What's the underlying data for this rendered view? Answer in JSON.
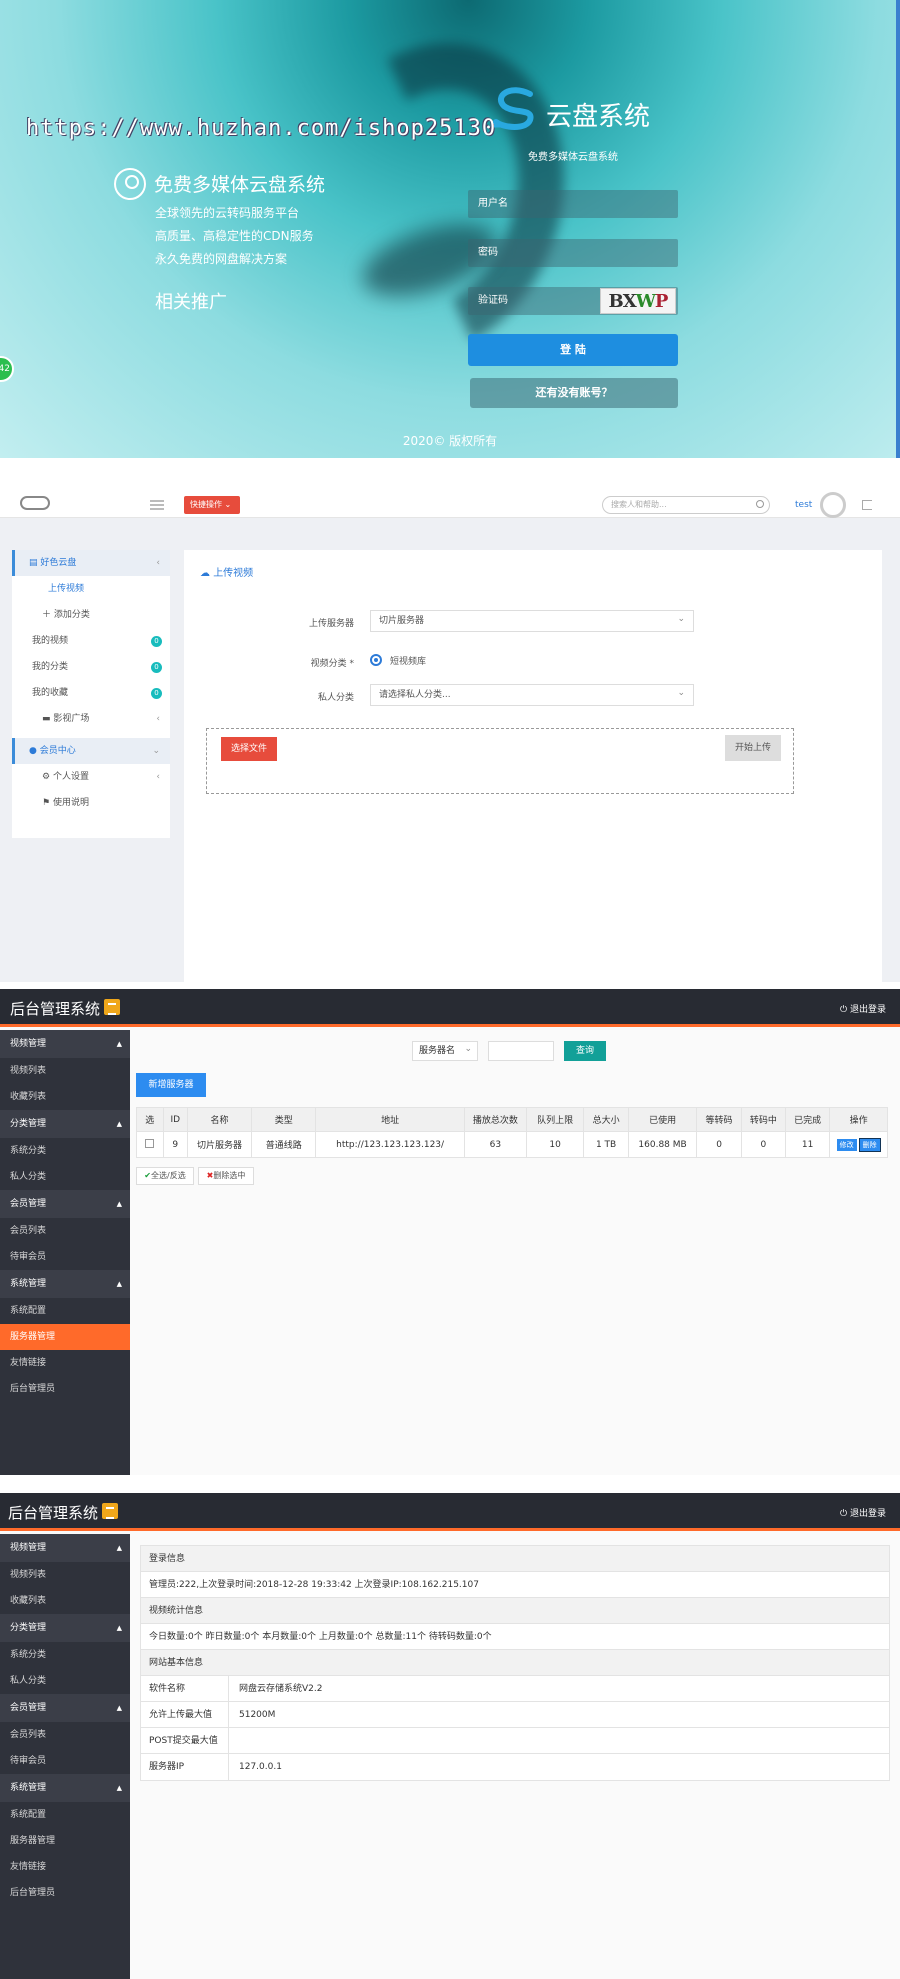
{
  "login": {
    "watermark": "https://www.huzhan.com/ishop25130",
    "logo_text": "云盘系统",
    "logo_sub": "免费多媒体云盘系统",
    "promo_title": "免费多媒体云盘系统",
    "promo_lines": [
      "全球领先的云转码服务平台",
      "高质量、高稳定性的CDN服务",
      "永久免费的网盘解决方案"
    ],
    "promo_more": "相关推广",
    "username_placeholder": "用户名",
    "password_placeholder": "密码",
    "captcha_placeholder": "验证码",
    "captcha_text": [
      "B",
      "X",
      "W",
      "P"
    ],
    "login_button": "登 陆",
    "register_button": "还有没有账号？",
    "copyright": "2020© 版权所有",
    "side_badge": "42"
  },
  "user": {
    "quick_button": "快捷操作 ⌄",
    "search_placeholder": "搜索人和帮助...",
    "username": "test",
    "sidebar": {
      "head": "好色云盘",
      "items": [
        {
          "label": "上传视频"
        },
        {
          "label": "添加分类"
        },
        {
          "label": "我的视频",
          "badge": "0"
        },
        {
          "label": "我的分类",
          "badge": "0"
        },
        {
          "label": "我的收藏",
          "badge": "0"
        },
        {
          "label": "影视广场"
        }
      ],
      "member_head": "会员中心",
      "member_items": [
        {
          "label": "个人设置"
        },
        {
          "label": "使用说明"
        }
      ]
    },
    "main_title": "上传视频",
    "form": {
      "server_label": "上传服务器",
      "server_value": "切片服务器",
      "category_label": "视频分类 *",
      "category_value": "短视频库",
      "private_label": "私人分类",
      "private_placeholder": "请选择私人分类..."
    },
    "choose_button": "选择文件",
    "start_button": "开始上传"
  },
  "admin": {
    "brand": "后台管理系统",
    "logout": "退出登录",
    "sidebar": [
      {
        "group": "视频管理",
        "items": [
          "视频列表",
          "收藏列表"
        ]
      },
      {
        "group": "分类管理",
        "items": [
          "系统分类",
          "私人分类"
        ]
      },
      {
        "group": "会员管理",
        "items": [
          "会员列表",
          "待审会员"
        ]
      },
      {
        "group": "系统管理",
        "items": [
          "系统配置",
          "服务器管理",
          "友情链接",
          "后台管理员"
        ]
      }
    ]
  },
  "servers": {
    "filter_select": "服务器名",
    "search_button": "查询",
    "add_button": "新增服务器",
    "columns": [
      "选",
      "ID",
      "名称",
      "类型",
      "地址",
      "播放总次数",
      "队列上限",
      "总大小",
      "已使用",
      "等转码",
      "转码中",
      "已完成",
      "操作"
    ],
    "rows": [
      {
        "id": "9",
        "name": "切片服务器",
        "type": "普通线路",
        "address": "http://123.123.123.123/",
        "plays": "63",
        "queue": "10",
        "total": "1 TB",
        "used": "160.88 MB",
        "waiting": "0",
        "transcoding": "0",
        "done": "11",
        "edit": "修改",
        "delete": "删除"
      }
    ],
    "select_all": "全选/反选",
    "delete_selected": "删除选中"
  },
  "dashboard": {
    "login_head": "登录信息",
    "login_info": "管理员:222,上次登录时间:2018-12-28 19:33:42 上次登录IP:108.162.215.107",
    "stats_head": "视频统计信息",
    "stats_info": "今日数量:0个 昨日数量:0个 本月数量:0个 上月数量:0个 总数量:11个 待转码数量:0个",
    "site_head": "网站基本信息",
    "site_rows": [
      {
        "k": "软件名称",
        "v": "网盘云存储系统V2.2"
      },
      {
        "k": "允许上传最大值",
        "v": "51200M"
      },
      {
        "k": "POST提交最大值",
        "v": ""
      },
      {
        "k": "服务器IP",
        "v": "127.0.0.1"
      }
    ]
  },
  "colors": {
    "accent": "#ff6a2a",
    "primary": "#2d8cf0",
    "danger": "#e74c3c",
    "teal": "#12a098"
  }
}
